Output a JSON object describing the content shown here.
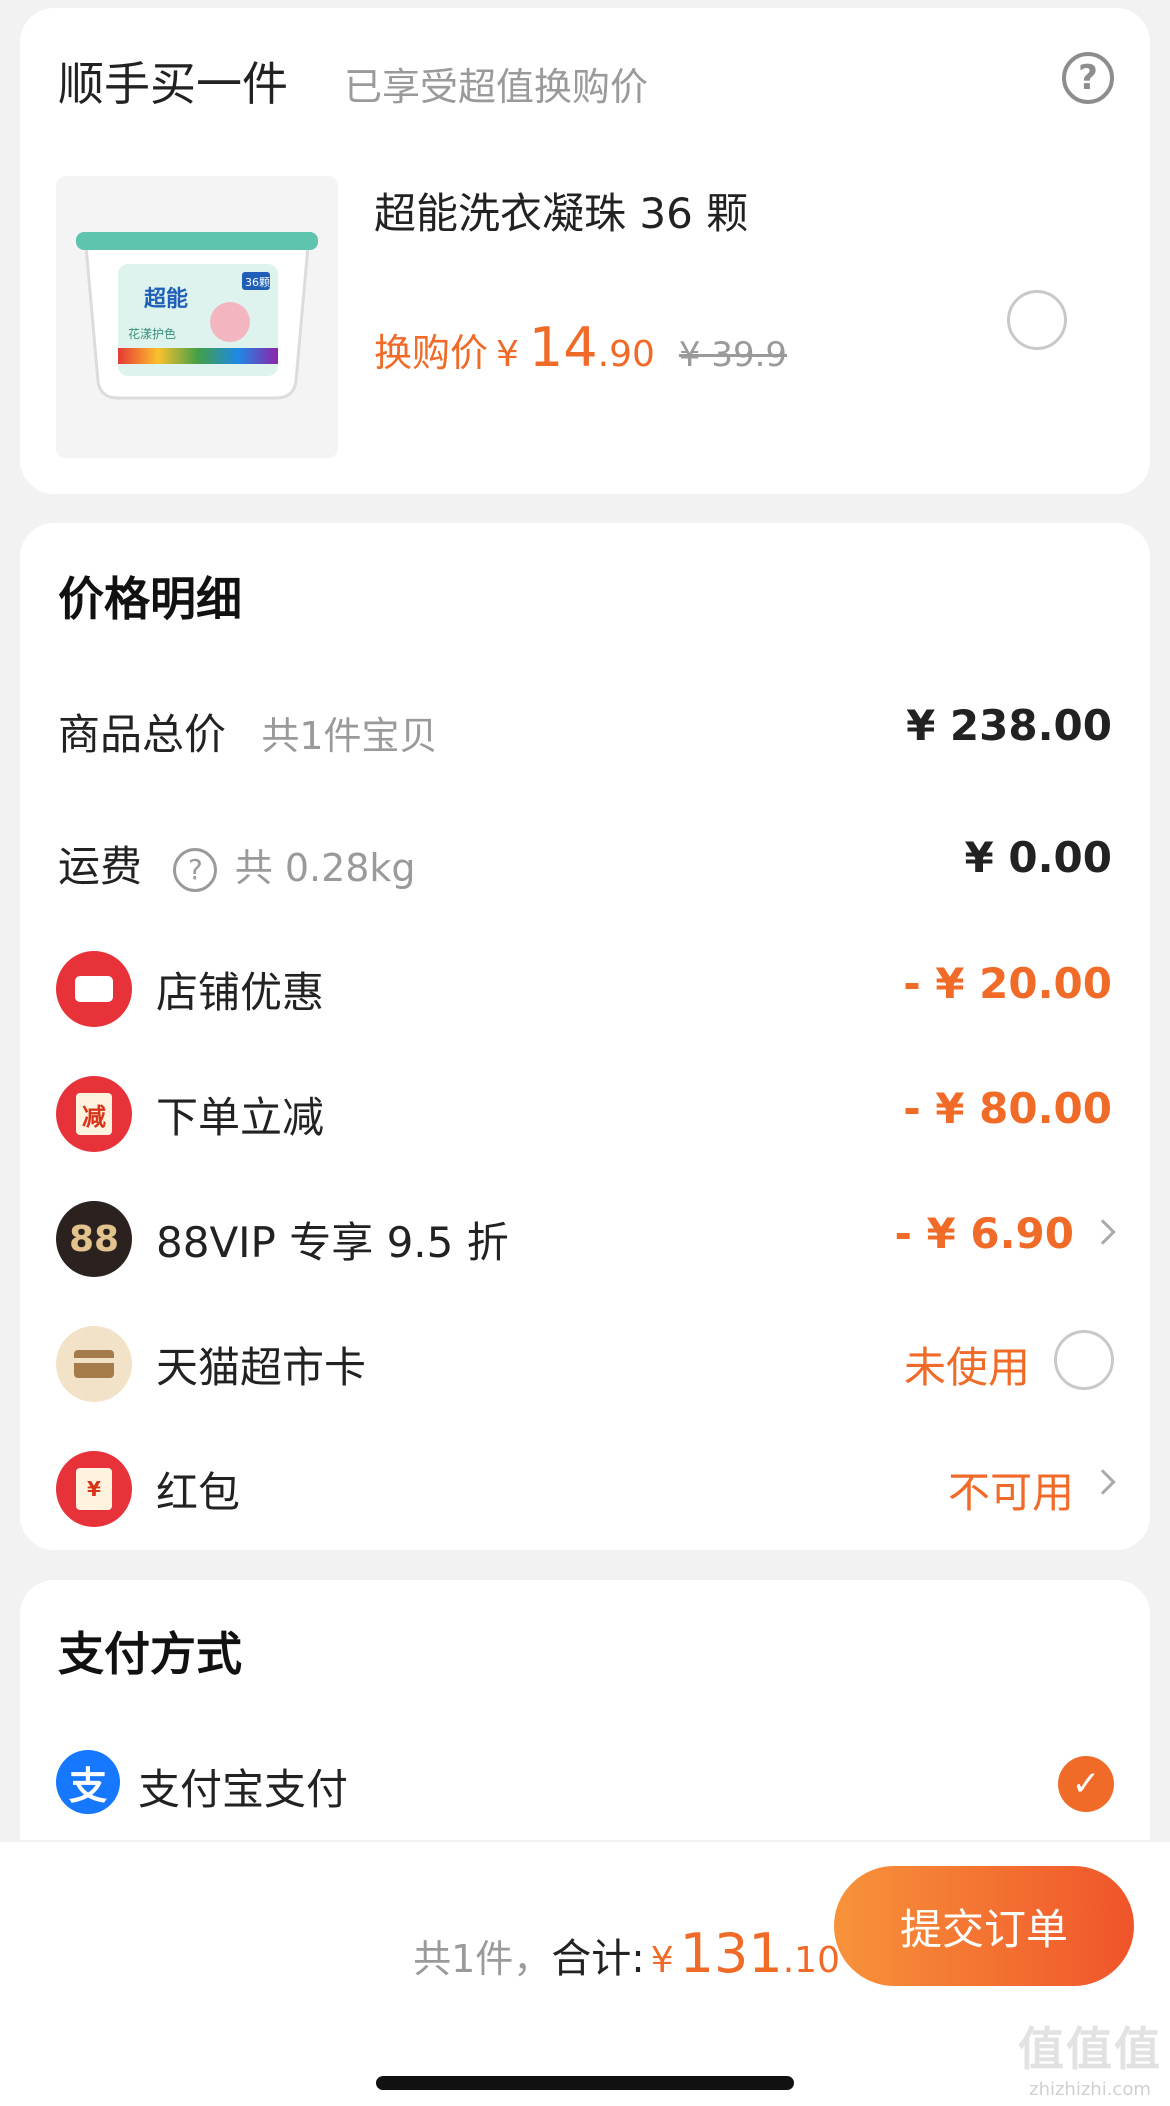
{
  "upsell": {
    "title": "顺手买一件",
    "subtitle": "已享受超值换购价",
    "product": {
      "name": "超能洗衣凝珠 36 颗",
      "price_label": "换购价",
      "currency": "¥",
      "price_integer": "14",
      "price_decimal": ".90",
      "original_price": "¥ 39.9",
      "image_brand": "超能",
      "image_badge": "36颗",
      "image_subtitle": "花漾护色"
    }
  },
  "price_details": {
    "title": "价格明细",
    "rows": [
      {
        "label": "商品总价",
        "hint": "共1件宝贝",
        "amount": "¥ 238.00"
      },
      {
        "label": "运费",
        "hint": "共 0.28kg",
        "amount": "¥ 0.00",
        "help_glyph": "?"
      },
      {
        "label": "店铺优惠",
        "amount": "- ¥ 20.00",
        "icon": "coupon-icon"
      },
      {
        "label": "下单立减",
        "amount": "- ¥ 80.00",
        "icon": "instant-discount-icon",
        "icon_text": "减"
      },
      {
        "label": "88VIP 专享 9.5 折",
        "amount": "- ¥ 6.90",
        "icon": "vip88-icon",
        "icon_text": "88"
      },
      {
        "label": "天猫超市卡",
        "amount": "未使用",
        "icon": "card-icon"
      },
      {
        "label": "红包",
        "amount": "不可用",
        "icon": "red-envelope-icon",
        "icon_text": "¥"
      }
    ]
  },
  "payment": {
    "title": "支付方式",
    "method": "支付宝支付",
    "method_icon_text": "支"
  },
  "footer": {
    "count": "共1件，",
    "total_label": "合计:",
    "currency": "¥",
    "total_integer": "131",
    "total_decimal": ".10",
    "submit_label": "提交订单"
  },
  "watermark": {
    "big": "值值值",
    "small": "zhizhizhi.com"
  },
  "colors": {
    "accent": "#f06a28",
    "background": "#f2f2f2",
    "alipay": "#1677ff"
  }
}
